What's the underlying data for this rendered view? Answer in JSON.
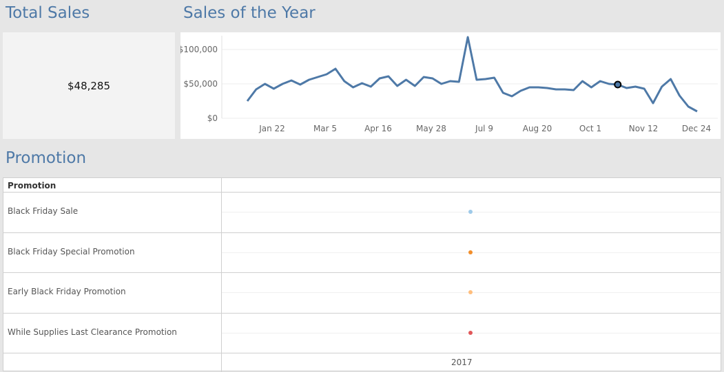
{
  "titles": {
    "total_sales": "Total Sales",
    "sales_of_year": "Sales of the Year",
    "promotion": "Promotion"
  },
  "kpi": {
    "value": "$48,285"
  },
  "chart_data": [
    {
      "type": "line",
      "title": "Sales of the Year",
      "y_ticks": [
        "$100,000",
        "$50,000",
        "$0"
      ],
      "y_tick_values": [
        100000,
        50000,
        0
      ],
      "x_ticks": [
        "Jan 22",
        "Mar 5",
        "Apr 16",
        "May 28",
        "Jul 9",
        "Aug 20",
        "Oct 1",
        "Nov 12",
        "Dec 24"
      ],
      "ylim": [
        0,
        120000
      ],
      "grid": true,
      "color": "#4e79a7",
      "x_week_index": [
        0,
        1,
        2,
        3,
        4,
        5,
        6,
        7,
        8,
        9,
        10,
        11,
        12,
        13,
        14,
        15,
        16,
        17,
        18,
        19,
        20,
        21,
        22,
        23,
        24,
        25,
        26,
        27,
        28,
        29,
        30,
        31,
        32,
        33,
        34,
        35,
        36,
        37,
        38,
        39,
        40,
        41,
        42,
        43,
        44,
        45,
        46,
        47,
        48,
        49,
        50,
        51
      ],
      "values": [
        25000,
        42000,
        50000,
        43000,
        50000,
        55000,
        49000,
        56000,
        60000,
        64000,
        72000,
        54000,
        45000,
        51000,
        46000,
        58000,
        61000,
        47000,
        56000,
        47000,
        60000,
        58000,
        50000,
        54000,
        53000,
        118000,
        56000,
        57000,
        59000,
        37000,
        32000,
        40000,
        45000,
        45000,
        44000,
        42000,
        42000,
        41000,
        54000,
        45000,
        54000,
        50000,
        49000,
        44000,
        46000,
        43000,
        22000,
        46000,
        57000,
        33000,
        17000,
        10000
      ],
      "highlight_index": 42
    },
    {
      "type": "scatter",
      "title": "Promotion",
      "row_header": "Promotion",
      "x_label": "2017",
      "series": [
        {
          "name": "Black Friday Sale",
          "x": "2017",
          "color": "#9ecae9"
        },
        {
          "name": "Black Friday Special Promotion",
          "x": "2017",
          "color": "#f28e2b"
        },
        {
          "name": "Early Black Friday Promotion",
          "x": "2017",
          "color": "#ffbe7d"
        },
        {
          "name": "While Supplies Last Clearance Promotion",
          "x": "2017",
          "color": "#e15759"
        }
      ]
    }
  ]
}
